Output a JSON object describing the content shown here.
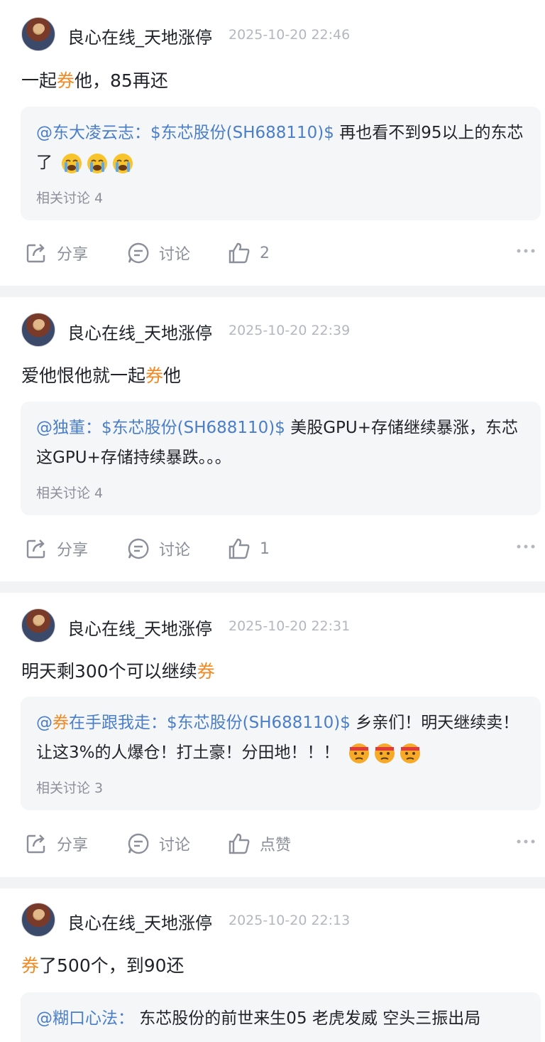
{
  "posts": [
    {
      "username": "良心在线_天地涨停",
      "time": "2025-10-20 22:46",
      "content": {
        "pre": "一起",
        "hl": "券",
        "post": "他，85再还"
      },
      "quote": {
        "mention_hl": "",
        "mention": "@东大凌云志：$东芯股份(SH688110)$",
        "text": " 再也看不到95以上的东芯了",
        "emoji_count": 3,
        "emoji_kind": "crying-face-emoji",
        "related": "相关讨论 4"
      },
      "share": "分享",
      "discuss": "讨论",
      "like": "2"
    },
    {
      "username": "良心在线_天地涨停",
      "time": "2025-10-20 22:39",
      "content": {
        "pre": "爱他恨他就一起",
        "hl": "券",
        "post": "他"
      },
      "quote": {
        "mention_hl": "",
        "mention": "@独董：$东芯股份(SH688110)$",
        "text": " 美股GPU+存储继续暴涨，东芯这GPU+存储持续暴跌。。。",
        "emoji_count": 0,
        "emoji_kind": "",
        "related": "相关讨论 4"
      },
      "share": "分享",
      "discuss": "讨论",
      "like": "1"
    },
    {
      "username": "良心在线_天地涨停",
      "time": "2025-10-20 22:31",
      "content": {
        "pre": "明天剩300个可以继续",
        "hl": "券",
        "post": ""
      },
      "quote": {
        "mention_pre": "@",
        "mention_hl": "券",
        "mention": "在手跟我走：$东芯股份(SH688110)$",
        "text": " 乡亲们！明天继续卖！让这3%的人爆仓！打土豪！分田地！！！",
        "emoji_count": 3,
        "emoji_kind": "shushing-face-emoji",
        "related": "相关讨论 3"
      },
      "share": "分享",
      "discuss": "讨论",
      "like": "点赞"
    },
    {
      "username": "良心在线_天地涨停",
      "time": "2025-10-20 22:13",
      "content": {
        "pre": "",
        "hl": "券",
        "post": "了500个，到90还"
      },
      "quote": {
        "mention_hl": "",
        "mention": "@糊口心法：",
        "text": " 东芯股份的前世来生05 老虎发威 空头三振出局",
        "emoji_count": 0,
        "emoji_kind": "",
        "related": ""
      },
      "share": "",
      "discuss": "",
      "like": ""
    }
  ],
  "colors": {
    "highlight": "#f08a24",
    "mention": "#4a7ec8",
    "muted": "#8a8f99",
    "time": "#b3b7be"
  }
}
